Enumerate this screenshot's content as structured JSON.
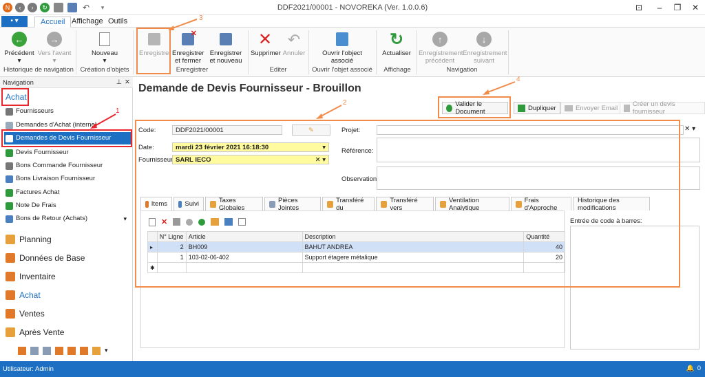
{
  "window": {
    "title": "DDF2021/00001 - NOVOREKA (Ver. 1.0.0.6)"
  },
  "tabs": {
    "file": "▪ ▾",
    "items": [
      "Accueil",
      "Affichage",
      "Outils"
    ]
  },
  "ribbon": {
    "precedent": "Précédent",
    "vers_avant": "Vers l'avant",
    "grp_history": "Historique de navigation",
    "nouveau": "Nouveau",
    "grp_creation": "Création d'objets",
    "enregistrer": "Enregistrer",
    "enregistrer_fermer": "Enregistrer et fermer",
    "enregistrer_nouveau": "Enregistrer et nouveau",
    "grp_enregistrer": "Enregistrer",
    "supprimer": "Supprimer",
    "annuler": "Annuler",
    "grp_editer": "Editer",
    "ouvrir_objet": "Ouvrir l'object associé",
    "grp_ouvrir": "Ouvrir l'objet associé",
    "actualiser": "Actualiser",
    "grp_affichage": "Affichage",
    "enr_precedent": "Enregistrement précédent",
    "enr_suivant": "Enregistrement suivant",
    "grp_navigation": "Navigation"
  },
  "annotations": {
    "n1": "1",
    "n2": "2",
    "n3": "3",
    "n4": "4"
  },
  "nav": {
    "header": "Navigation",
    "group": "Achat",
    "items": [
      "Fournisseurs",
      "Demandes d'Achat (interne)",
      "Demandes de Devis Fournisseur",
      "Devis Fournisseur",
      "Bons Commande Fournisseur",
      "Bons Livraison Fournisseur",
      "Factures Achat",
      "Note De Frais",
      "Bons de Retour (Achats)"
    ],
    "modules": [
      "Planning",
      "Données de Base",
      "Inventaire",
      "Achat",
      "Ventes",
      "Après Vente"
    ]
  },
  "page": {
    "title": "Demande de Devis Fournisseur - Brouillon"
  },
  "actions": {
    "valider": "Valider le Document",
    "dupliquer": "Dupliquer",
    "envoyer": "Envoyer Email",
    "creer": "Créer un devis fournisseur"
  },
  "form": {
    "code_label": "Code:",
    "code_value": "DDF2021/00001",
    "date_label": "Date:",
    "date_value": "mardi 23 février 2021 16:18:30",
    "fournisseur_label": "Fournisseur:",
    "fournisseur_value": "SARL IECO",
    "projet_label": "Projet:",
    "reference_label": "Référence:",
    "observation_label": "Observation:"
  },
  "subtabs": [
    "Items",
    "Suivi",
    "Taxes Globales",
    "Pièces Jointes",
    "Transféré du",
    "Transféré vers",
    "Ventilation Analytique",
    "Frais d'Approche",
    "Historique des modifications"
  ],
  "grid": {
    "columns": [
      "N° Ligne",
      "Article",
      "Description",
      "Quantité"
    ],
    "rows": [
      {
        "ligne": "2",
        "article": "BH009",
        "description": "BAHUT ANDREA",
        "quantite": "40"
      },
      {
        "ligne": "1",
        "article": "103-02-06-402",
        "description": "Support étagere métalique",
        "quantite": "20"
      }
    ]
  },
  "barcode": {
    "label": "Entrée de code à barres:"
  },
  "status": {
    "user": "Utilisateur: Admin",
    "notif": "0"
  },
  "colors": {
    "accent": "#1c6fc2",
    "annotation_orange": "#f08b4a",
    "annotation_red": "#e8262c"
  }
}
